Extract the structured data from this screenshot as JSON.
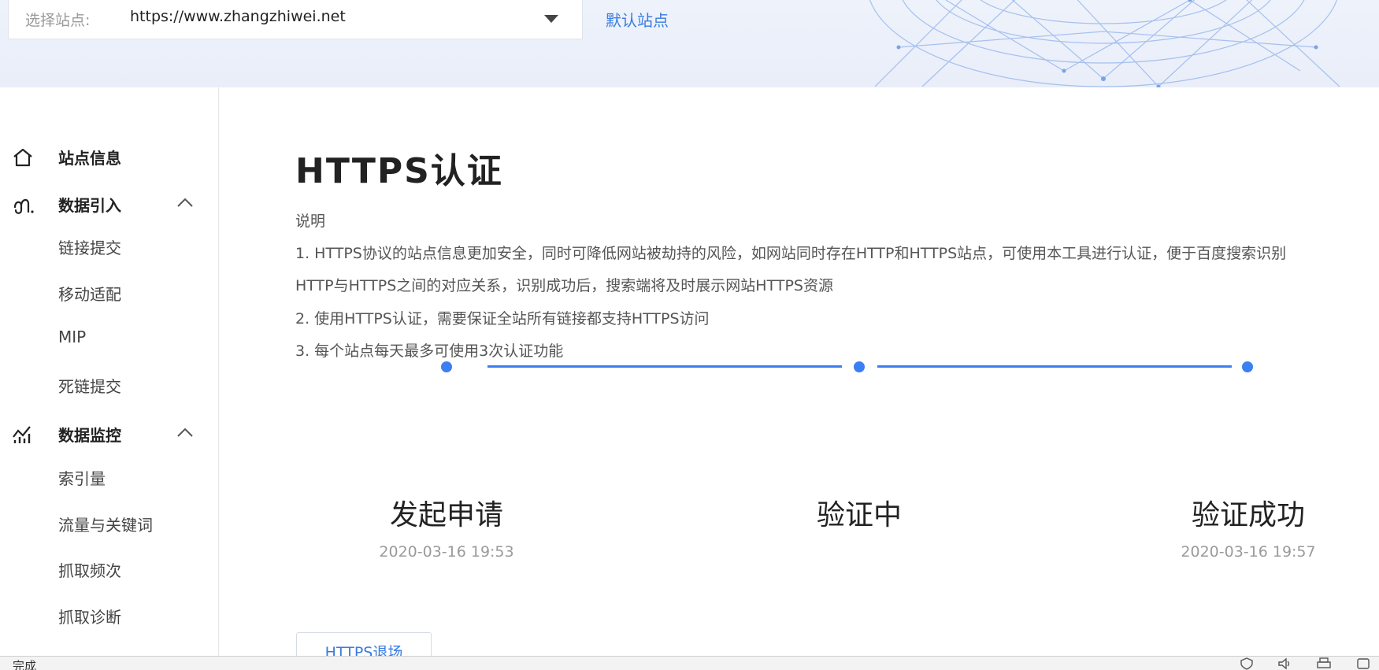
{
  "site_selector": {
    "label": "选择站点:",
    "value": "https://www.zhangzhiwei.net",
    "default_site_link": "默认站点"
  },
  "sidebar": {
    "site_info": {
      "label": "站点信息",
      "icon": "home-icon"
    },
    "data_import": {
      "label": "数据引入",
      "icon": "data-import-icon",
      "expanded": true,
      "items": [
        "链接提交",
        "移动适配",
        "MIP",
        "死链提交"
      ]
    },
    "data_monitor": {
      "label": "数据监控",
      "icon": "chart-icon",
      "expanded": true,
      "items": [
        "索引量",
        "流量与关键词",
        "抓取频次",
        "抓取诊断"
      ]
    }
  },
  "main": {
    "title": "HTTPS认证",
    "description_heading": "说明",
    "description_lines": [
      "1. HTTPS协议的站点信息更加安全，同时可降低网站被劫持的风险，如网站同时存在HTTP和HTTPS站点，可使用本工具进行认证，便于百度搜索识别",
      "HTTP与HTTPS之间的对应关系，识别成功后，搜索端将及时展示网站HTTPS资源",
      "2. 使用HTTPS认证，需要保证全站所有链接都支持HTTPS访问",
      "3. 每个站点每天最多可使用3次认证功能"
    ],
    "steps": [
      {
        "label": "发起申请",
        "time": "2020-03-16 19:53"
      },
      {
        "label": "验证中",
        "time": ""
      },
      {
        "label": "验证成功",
        "time": "2020-03-16 19:57"
      }
    ],
    "revert_button": "HTTPS退场"
  },
  "statusbar": {
    "text": "完成"
  },
  "colors": {
    "accent": "#3b7ff2",
    "link": "#3a7be0"
  }
}
